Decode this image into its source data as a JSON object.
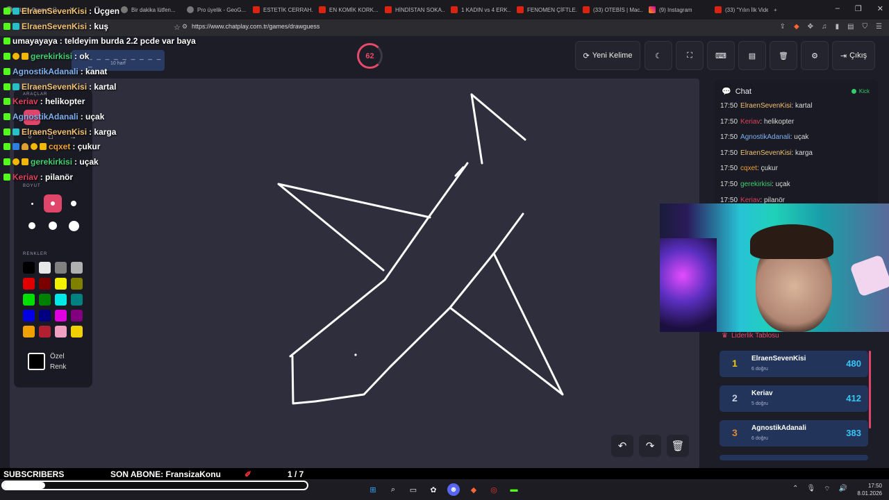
{
  "browser": {
    "tabs": [
      {
        "label": "Çizim Oyunu - Ü...",
        "active": false,
        "icon": "app-icon"
      },
      {
        "label": "Bir dakika lütfen...",
        "active": false,
        "icon": "globe-icon"
      },
      {
        "label": "Pro üyelik - GeoG...",
        "active": false,
        "icon": "globe-icon"
      },
      {
        "label": "ESTETİK CERRAH...",
        "active": false,
        "icon": "youtube-icon"
      },
      {
        "label": "EN KOMİK KORK...",
        "active": false,
        "icon": "youtube-icon"
      },
      {
        "label": "HİNDİSTAN SOKA...",
        "active": false,
        "icon": "youtube-icon"
      },
      {
        "label": "1 KADIN vs 4 ERK...",
        "active": false,
        "icon": "youtube-icon"
      },
      {
        "label": "FENOMEN ÇİFTLE...",
        "active": false,
        "icon": "youtube-icon"
      },
      {
        "label": "(33) OTEBİS | Mac...",
        "active": false,
        "icon": "youtube-icon"
      },
      {
        "label": "(9) Instagram",
        "active": false,
        "icon": "instagram-icon"
      },
      {
        "label": "(33) \"Yılın İlk Vide...",
        "active": false,
        "icon": "youtube-icon"
      }
    ],
    "new_tab": "+",
    "url": "https://www.chatplay.com.tr/games/drawguess",
    "window_controls": [
      "–",
      "❐",
      "✕"
    ]
  },
  "game": {
    "word_mask": "_ _ _ _ _ _ _ _ _ _",
    "word_hint": "10 harf",
    "timer": "62",
    "buttons": {
      "new_word": "Yeni Kelime",
      "exit": "Çıkış"
    }
  },
  "tools": {
    "tools_label": "ARAÇLAR",
    "size_label": "BOYUT",
    "colors_label": "RENKLER",
    "custom_color_label": "Özel Renk",
    "palette": [
      "#000000",
      "#e8e8e8",
      "#808080",
      "#b0b0b0",
      "#e00000",
      "#7a0000",
      "#f0f000",
      "#808000",
      "#00e000",
      "#008000",
      "#00e8e8",
      "#008080",
      "#0000e0",
      "#000080",
      "#e000e0",
      "#800080",
      "#f0a000",
      "#b02030",
      "#f0a0c0",
      "#f0d000"
    ],
    "selected_size_index": 1
  },
  "chat": {
    "title": "Chat",
    "status": "Kick",
    "messages": [
      {
        "time": "17:50",
        "user": "ElraenSevenKisi",
        "user_color": "#f0c070",
        "text": ": kartal"
      },
      {
        "time": "17:50",
        "user": "Keriav",
        "user_color": "#e0405a",
        "text": ": helikopter"
      },
      {
        "time": "17:50",
        "user": "AgnostikAdanali",
        "user_color": "#7fb0f0",
        "text": ": uçak"
      },
      {
        "time": "17:50",
        "user": "ElraenSevenKisi",
        "user_color": "#f0c070",
        "text": ": karga"
      },
      {
        "time": "17:50",
        "user": "cqxet",
        "user_color": "#f0a030",
        "text": ": çukur"
      },
      {
        "time": "17:50",
        "user": "gerekirkisi",
        "user_color": "#40d070",
        "text": ": uçak"
      },
      {
        "time": "17:50",
        "user": "Keriav",
        "user_color": "#e0405a",
        "text": ": pilanör"
      }
    ]
  },
  "leaderboard": {
    "title": "Liderlik Tablosu",
    "entries": [
      {
        "rank": "1",
        "name": "ElraenSevenKisi",
        "sub": "6 doğru",
        "score": "480",
        "rank_color": "#f2c40a"
      },
      {
        "rank": "2",
        "name": "Keriav",
        "sub": "5 doğru",
        "score": "412",
        "rank_color": "#c8d0e0"
      },
      {
        "rank": "3",
        "name": "AgnostikAdanali",
        "sub": "6 doğru",
        "score": "383",
        "rank_color": "#e08a30"
      }
    ]
  },
  "overlay_chat": [
    {
      "user": "ElraenSevenKisi",
      "color": "#f0c070",
      "msg": ": Üçgen",
      "badges": [
        "b-kick",
        "b-gift"
      ]
    },
    {
      "user": "ElraenSevenKisi",
      "color": "#f0c070",
      "msg": ": kuş",
      "badges": [
        "b-kick",
        "b-gift"
      ]
    },
    {
      "user": "umayayaya",
      "color": "#ffffff",
      "msg": ": teldeyim burda 2.2 pcde var baya",
      "badges": [
        "b-kick"
      ]
    },
    {
      "user": "gerekirkisi",
      "color": "#40d070",
      "msg": ": ok",
      "badges": [
        "b-kick",
        "b-warn",
        "b-crown"
      ]
    },
    {
      "user": "AgnostikAdanali",
      "color": "#7fb0f0",
      "msg": ": kanat",
      "badges": [
        "b-kick"
      ]
    },
    {
      "user": "ElraenSevenKisi",
      "color": "#f0c070",
      "msg": ": kartal",
      "badges": [
        "b-kick",
        "b-gift"
      ]
    },
    {
      "user": "Keriav",
      "color": "#e0405a",
      "msg": ": helikopter",
      "badges": [
        "b-kick"
      ]
    },
    {
      "user": "AgnostikAdanali",
      "color": "#7fb0f0",
      "msg": ": uçak",
      "badges": [
        "b-kick"
      ]
    },
    {
      "user": "ElraenSevenKisi",
      "color": "#f0c070",
      "msg": ": karga",
      "badges": [
        "b-kick",
        "b-gift"
      ]
    },
    {
      "user": "cqxet",
      "color": "#f0a030",
      "msg": ": çukur",
      "badges": [
        "b-kick",
        "b-blue",
        "b-bell",
        "b-warn",
        "b-crown"
      ]
    },
    {
      "user": "gerekirkisi",
      "color": "#40d070",
      "msg": ": uçak",
      "badges": [
        "b-kick",
        "b-warn",
        "b-crown"
      ]
    },
    {
      "user": "Keriav",
      "color": "#e0405a",
      "msg": ": pilanör",
      "badges": [
        "b-kick"
      ]
    }
  ],
  "stream_bar": {
    "subscribers": "SUBSCRIBERS",
    "last_sub": "SON ABONE: FransizaKonu",
    "counter": "1 / 7",
    "progress": 0.14
  },
  "taskbar": {
    "time": "17:50",
    "date": "8.01.2026"
  }
}
